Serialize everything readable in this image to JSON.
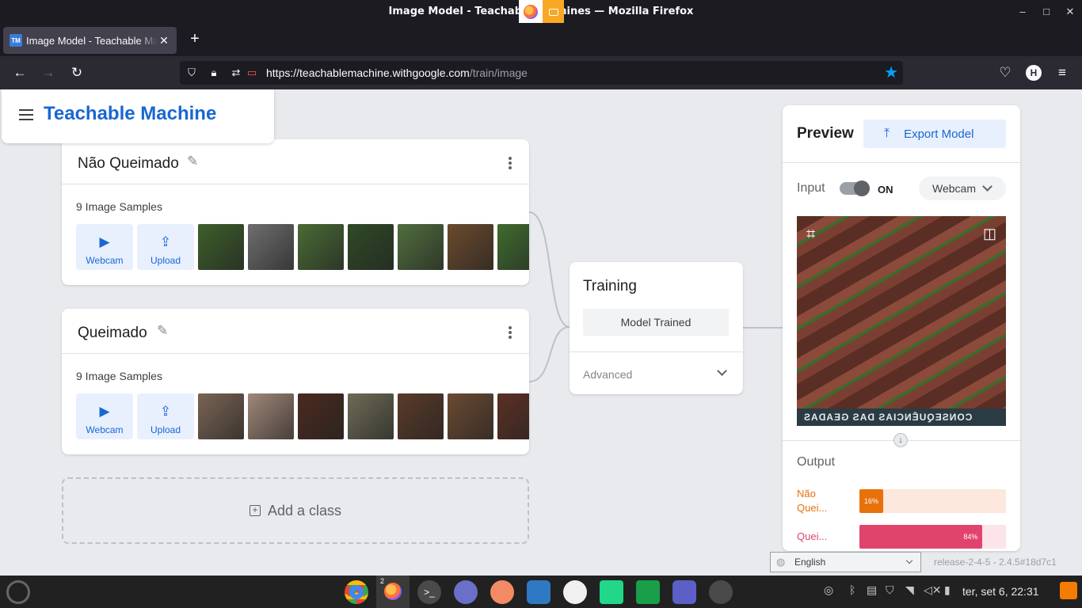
{
  "window": {
    "title": "Image Model - Teachable Machines — Mozilla Firefox",
    "controls": [
      "–",
      "□",
      "✕"
    ]
  },
  "browser": {
    "tab_title": "Image Model - Teachable Machine",
    "tab_favicon": "TM",
    "url_host": "https://teachablemachine.withgoogle.com",
    "url_path": "/train/image",
    "profile_initial": "H"
  },
  "app": {
    "name": "Teachable Machine"
  },
  "classes": [
    {
      "name": "Não Queimado",
      "samples": "9 Image Samples",
      "webcam_label": "Webcam",
      "upload_label": "Upload",
      "thumb_colors": [
        "#3e5f2a",
        "#6e6e6e",
        "#4a6b34",
        "#2f4a26",
        "#506e3d",
        "#6b4a2c",
        "#3f6b2f"
      ]
    },
    {
      "name": "Queimado",
      "samples": "9 Image Samples",
      "webcam_label": "Webcam",
      "upload_label": "Upload",
      "thumb_colors": [
        "#7a6455",
        "#a08878",
        "#4a2a1f",
        "#6e6b55",
        "#5a3a28",
        "#6b4a32",
        "#5a3024"
      ]
    }
  ],
  "add_class_label": "Add a class",
  "training": {
    "title": "Training",
    "status_button": "Model Trained",
    "advanced_label": "Advanced"
  },
  "preview": {
    "title": "Preview",
    "export_label": "Export Model",
    "input_label": "Input",
    "input_state": "ON",
    "source_label": "Webcam",
    "feed_caption": "CONSEQUÊNCIAS DAS GEADAS",
    "output_label": "Output",
    "outputs": [
      {
        "label": "Não Quei...",
        "percent_text": "16%",
        "value": 0.16,
        "color": "#e8710a",
        "bg": "#fce8dc"
      },
      {
        "label": "Quei...",
        "percent_text": "84%",
        "value": 0.84,
        "color": "#e0446d",
        "bg": "#fce4ea"
      }
    ]
  },
  "language_select": "English",
  "release_text": "release-2-4-5 - 2.4.5#18d7c1",
  "taskbar": {
    "firefox_badge": "2",
    "clock": "ter, set  6, 22:31"
  }
}
